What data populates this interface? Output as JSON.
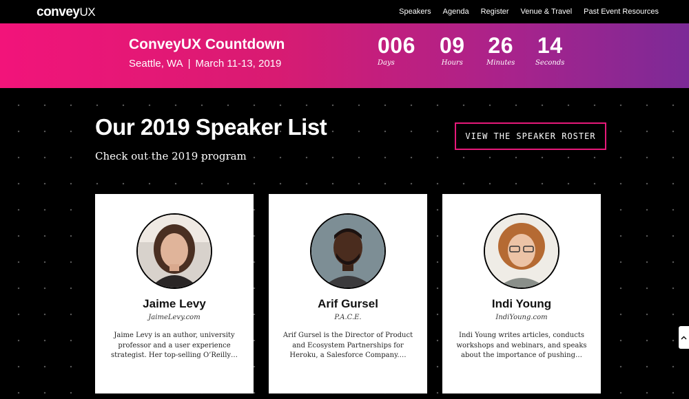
{
  "brand": {
    "logo_bold": "convey",
    "logo_light": "UX"
  },
  "nav": {
    "items": [
      "Speakers",
      "Agenda",
      "Register",
      "Venue & Travel",
      "Past Event Resources"
    ]
  },
  "banner": {
    "title": "ConveyUX Countdown",
    "location": "Seattle, WA",
    "separator": "|",
    "dates": "March 11-13, 2019",
    "countdown": [
      {
        "value": "006",
        "label": "Days"
      },
      {
        "value": "09",
        "label": "Hours"
      },
      {
        "value": "26",
        "label": "Minutes"
      },
      {
        "value": "14",
        "label": "Seconds"
      }
    ],
    "colors": {
      "start": "#f2147a",
      "end": "#7c2a97"
    }
  },
  "speakers_section": {
    "title": "Our 2019 Speaker List",
    "subtitle": "Check out the 2019 program",
    "roster_button": "VIEW THE SPEAKER ROSTER",
    "accent": "#e8197a"
  },
  "speakers": [
    {
      "name": "Jaime Levy",
      "org": "JaimeLevy.com",
      "bio": "Jaime Levy is an author, university professor and a user experience strategist. Her top-selling O’Reilly…",
      "avatar": "portrait-photo-woman-dark-hair"
    },
    {
      "name": "Arif Gursel",
      "org": "P.A.C.E.",
      "bio": "Arif Gursel is the Director of Product and Ecosystem Partnerships for Heroku, a Salesforce Company.…",
      "avatar": "portrait-photo-man-beard"
    },
    {
      "name": "Indi Young",
      "org": "IndiYoung.com",
      "bio": "Indi Young writes articles, conducts workshops and webinars, and speaks about the importance of pushing…",
      "avatar": "portrait-photo-woman-curly-hair-glasses"
    }
  ],
  "side_tab": {
    "icon": "chevron-up-icon"
  }
}
